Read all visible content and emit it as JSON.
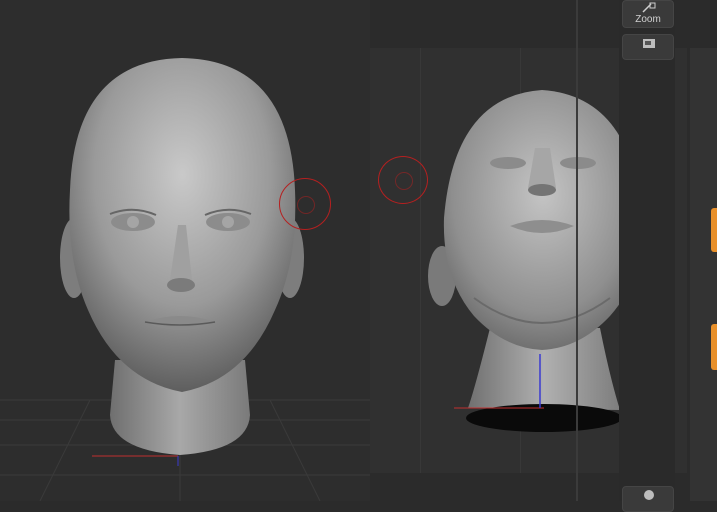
{
  "toolbar": {
    "zoom_label": "Zoom",
    "zoom_icon": "zoom-icon",
    "second_icon": "render-icon",
    "third_icon": "render-icon"
  },
  "colors": {
    "background": "#2b2b2b",
    "brush_ring": "#b52020",
    "accent_orange": "#e8902a",
    "axis_red": "#c03030",
    "axis_blue": "#3a3ad0"
  },
  "viewports": [
    {
      "name": "front-view",
      "model": "female-head-sculpt"
    },
    {
      "name": "low-angle-view",
      "model": "female-head-sculpt"
    }
  ]
}
